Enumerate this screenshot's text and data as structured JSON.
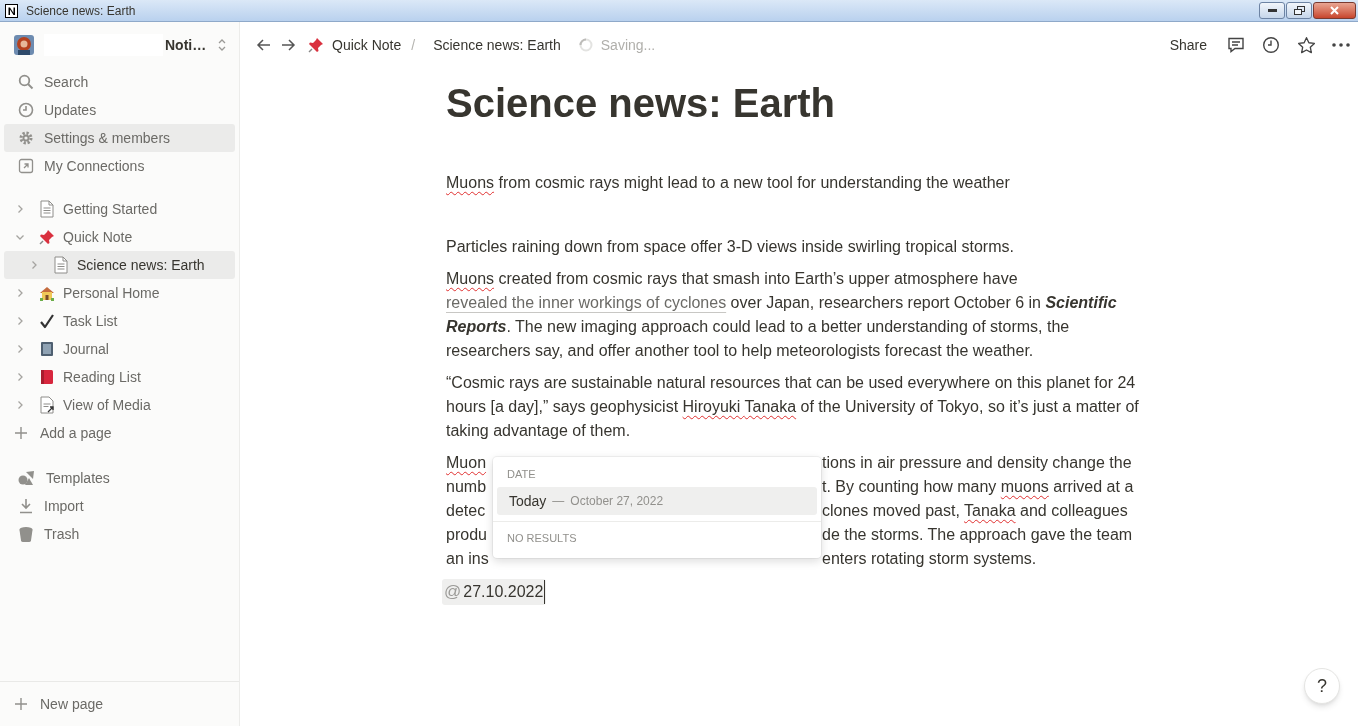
{
  "window": {
    "title": "Science news: Earth"
  },
  "sidebar": {
    "workspace": "Noti…",
    "nav": [
      {
        "label": "Search",
        "selected": false
      },
      {
        "label": "Updates",
        "selected": false
      },
      {
        "label": "Settings & members",
        "selected": true
      },
      {
        "label": "My Connections",
        "selected": false
      }
    ],
    "pages": [
      {
        "label": "Getting Started",
        "expanded": false,
        "selected": false
      },
      {
        "label": "Quick Note",
        "expanded": true,
        "selected": false,
        "children": [
          {
            "label": "Science news: Earth",
            "expanded": false,
            "selected": true
          }
        ]
      },
      {
        "label": "Personal Home",
        "expanded": false,
        "selected": false
      },
      {
        "label": "Task List",
        "expanded": false,
        "selected": false
      },
      {
        "label": "Journal",
        "expanded": false,
        "selected": false
      },
      {
        "label": "Reading List",
        "expanded": false,
        "selected": false
      },
      {
        "label": "View of Media",
        "expanded": false,
        "selected": false
      }
    ],
    "add_page": "Add a page",
    "tools": [
      "Templates",
      "Import",
      "Trash"
    ],
    "new_page": "New page"
  },
  "topbar": {
    "breadcrumbs": [
      "Quick Note",
      "Science news: Earth"
    ],
    "separator": "/",
    "status": "Saving...",
    "share": "Share"
  },
  "page": {
    "title": "Science news: Earth",
    "blocks": [
      {
        "kind": "paragraph",
        "segments": [
          {
            "text": "Muons",
            "kind": "misspelled"
          },
          {
            "text": " from cosmic rays might lead to a new tool for understanding the weather",
            "kind": "plain"
          }
        ]
      },
      {
        "kind": "paragraph",
        "segments": [
          {
            "text": "Particles raining down from space offer 3-D views inside swirling tropical storms.",
            "kind": "plain"
          }
        ]
      },
      {
        "kind": "paragraph",
        "segments": [
          {
            "text": "Muons",
            "kind": "misspelled"
          },
          {
            "text": " created from cosmic rays that smash into Earth’s upper atmosphere have ",
            "kind": "plain"
          },
          {
            "text": "revealed the inner workings of cyclones",
            "kind": "link"
          },
          {
            "text": " over Japan, researchers report October 6 in ",
            "kind": "plain"
          },
          {
            "text": "Scientific Reports",
            "kind": "emphasis"
          },
          {
            "text": ". The new imaging approach could lead to a better understanding of storms, the researchers say, and offer another tool to help meteorologists forecast the weather.",
            "kind": "plain"
          }
        ]
      },
      {
        "kind": "paragraph",
        "segments": [
          {
            "text": "“Cosmic rays are sustainable natural resources that can be used everywhere on this planet for 24 hours [a day],” says geophysicist ",
            "kind": "plain"
          },
          {
            "text": "Hiroyuki ",
            "kind": "misspelled"
          },
          {
            "text": "Tanaka",
            "kind": "misspelled"
          },
          {
            "text": " of the University of Tokyo, so it’s just a matter of taking advantage of them.",
            "kind": "plain"
          }
        ]
      },
      {
        "kind": "covered",
        "lines": [
          {
            "left": [
              {
                "text": "Muon",
                "kind": "misspelled"
              }
            ],
            "right": [
              {
                "text": "tions in air pressure and density change the",
                "kind": "plain"
              }
            ]
          },
          {
            "left": [
              {
                "text": "numb",
                "kind": "plain"
              }
            ],
            "right": [
              {
                "text": "t. By counting how many ",
                "kind": "plain"
              },
              {
                "text": "muons",
                "kind": "misspelled"
              },
              {
                "text": " arrived at a",
                "kind": "plain"
              }
            ]
          },
          {
            "left": [
              {
                "text": "detec",
                "kind": "plain"
              }
            ],
            "right": [
              {
                "text": "clones moved past, ",
                "kind": "plain"
              },
              {
                "text": "Tanaka",
                "kind": "misspelled"
              },
              {
                "text": " and colleagues",
                "kind": "plain"
              }
            ]
          },
          {
            "left": [
              {
                "text": "produ",
                "kind": "plain"
              }
            ],
            "right": [
              {
                "text": "de the storms. The approach gave the team",
                "kind": "plain"
              }
            ]
          },
          {
            "left": [
              {
                "text": "an ins",
                "kind": "plain"
              }
            ],
            "right": [
              {
                "text": "enters rotating storm systems.",
                "kind": "plain"
              }
            ]
          }
        ]
      }
    ],
    "mention": {
      "symbol": "@",
      "value": "27.10.2022"
    }
  },
  "popup": {
    "section": "DATE",
    "options": [
      {
        "label": "Today",
        "separator": "—",
        "detail": "October 27, 2022",
        "selected": true
      }
    ],
    "empty": "NO RESULTS"
  },
  "help": "?"
}
